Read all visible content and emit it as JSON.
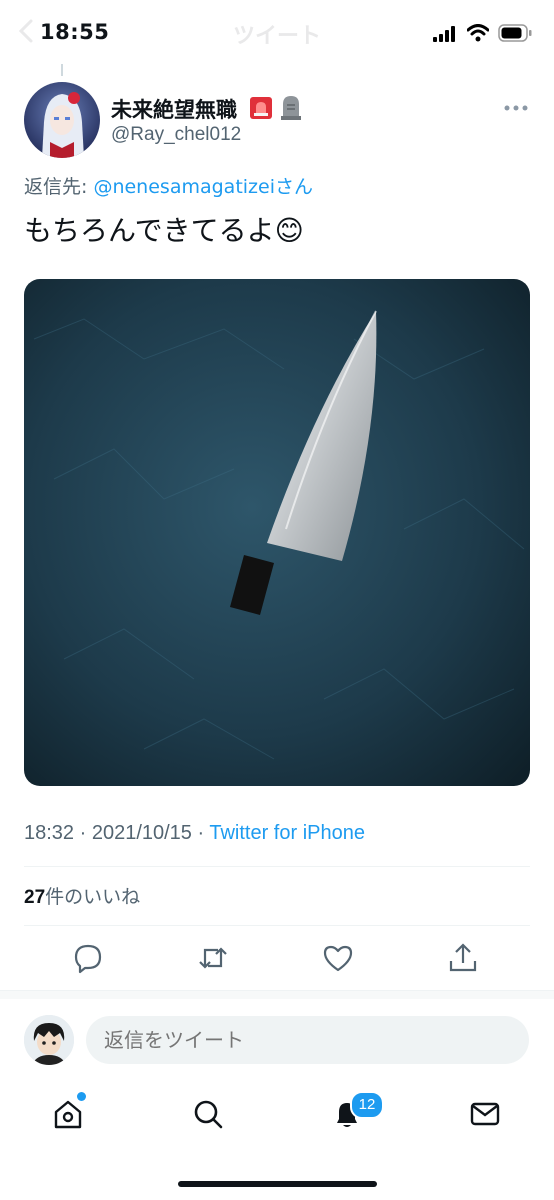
{
  "status_bar": {
    "time": "18:55"
  },
  "header": {
    "title": "ツイート"
  },
  "tweet": {
    "display_name": "未来絶望無職",
    "name_emojis": [
      "rotating-light-icon",
      "headstone-icon"
    ],
    "handle": "@Ray_chel012",
    "reply_prefix": "返信先: ",
    "reply_mention": "@nenesamagatizei",
    "reply_suffix": "さん",
    "text": "もちろんできてるよ😊",
    "image_alt": "kitchen knife on dark blue paper",
    "timestamp": "18:32 · 2021/10/15 · ",
    "source": "Twitter for iPhone",
    "like_count": "27",
    "like_label": "件のいいね"
  },
  "actions": [
    "reply-icon",
    "retweet-icon",
    "like-icon",
    "share-icon"
  ],
  "reply_bar": {
    "placeholder": "返信をツイート"
  },
  "tab_bar": {
    "tabs": [
      "home-icon",
      "search-icon",
      "notifications-icon",
      "messages-icon"
    ],
    "notification_count": "12"
  },
  "colors": {
    "accent": "#1d9bf0",
    "text": "#0f1419",
    "secondary": "#536471"
  }
}
